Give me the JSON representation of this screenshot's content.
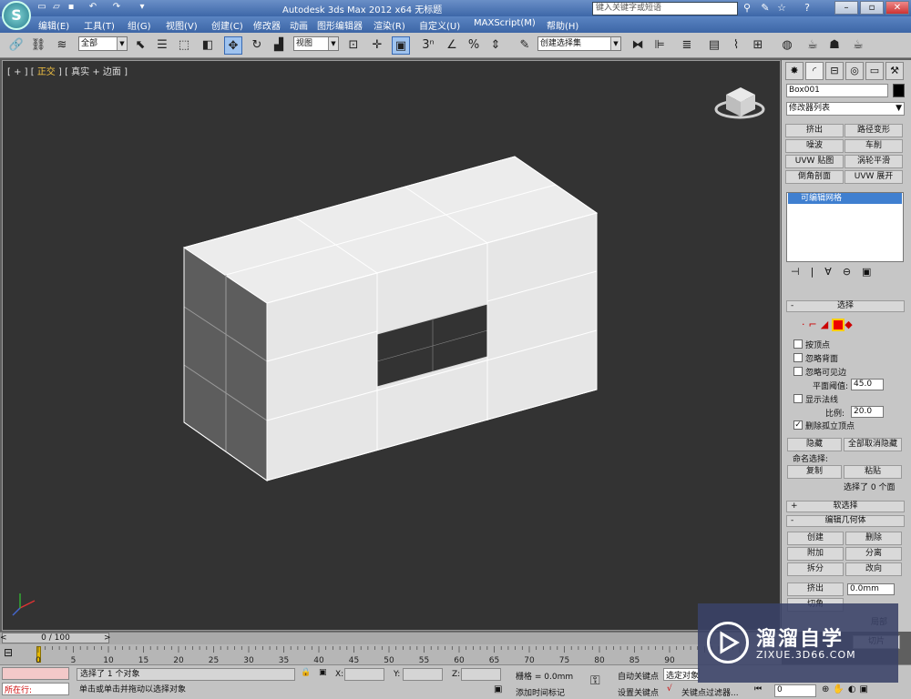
{
  "titlebar": {
    "title": "Autodesk 3ds Max  2012 x64      无标题",
    "search_placeholder": "键入关键字或短语"
  },
  "menu": [
    "编辑(E)",
    "工具(T)",
    "组(G)",
    "视图(V)",
    "创建(C)",
    "修改器",
    "动画",
    "图形编辑器",
    "渲染(R)",
    "自定义(U)",
    "MAXScript(M)",
    "帮助(H)"
  ],
  "toolbar": {
    "selection_filter": "全部",
    "ref_coord": "视图",
    "named_selection": "创建选择集",
    "snap_label": "3"
  },
  "viewport": {
    "label_prefix": "[ + ] [ ",
    "view_name": "正交",
    "label_suffix": " ] [ 真实 + 边面 ]",
    "background": "#333333"
  },
  "command_panel": {
    "object_name": "Box001",
    "modifier_list": "修改器列表",
    "modifier_buttons": [
      "挤出",
      "路径变形",
      "噪波",
      "车削",
      "UVW 贴图",
      "涡轮平滑",
      "倒角剖面",
      "UVW 展开"
    ],
    "stack_item": "可编辑网格",
    "selection": {
      "title": "选择",
      "by_vertex": "按顶点",
      "ignore_backfacing": "忽略背面",
      "ignore_visible_edges": "忽略可见边",
      "planar_threshold_label": "平面阈值:",
      "planar_threshold": "45.0",
      "show_normals": "显示法线",
      "scale_label": "比例:",
      "scale": "20.0",
      "delete_isolated": "删除孤立顶点",
      "hide": "隐藏",
      "unhide_all": "全部取消隐藏",
      "named_sel_label": "命名选择:",
      "copy": "复制",
      "paste": "粘贴",
      "selected_count": "选择了 0 个面"
    },
    "soft_selection": "软选择",
    "edit_geometry": {
      "title": "编辑几何体",
      "create": "创建",
      "delete": "删除",
      "attach": "附加",
      "detach": "分离",
      "divide": "拆分",
      "turn": "改向",
      "extrude": "挤出",
      "extrude_value": "0.0mm",
      "chamfer": "切角",
      "local": "局部",
      "slice": "切片"
    }
  },
  "timeline": {
    "frame_counter": "0 / 100",
    "ticks": [
      0,
      5,
      10,
      15,
      20,
      25,
      30,
      35,
      40,
      45,
      50,
      55,
      60,
      65,
      70,
      75,
      80,
      85,
      90
    ]
  },
  "status": {
    "running": "所在行:",
    "selected": "选择了 1 个对象",
    "hint": "单击或单击并拖动以选择对象",
    "x_label": "X:",
    "y_label": "Y:",
    "z_label": "Z:",
    "grid": "栅格 = 0.0mm",
    "add_time_tag": "添加时间标记",
    "auto_key": "自动关键点",
    "selected_obj": "选定对象",
    "set_key": "设置关键点",
    "key_filters": "关键点过滤器...",
    "frame": "0"
  },
  "watermark": {
    "name": "溜溜自学",
    "url": "ZIXUE.3D66.COM"
  }
}
